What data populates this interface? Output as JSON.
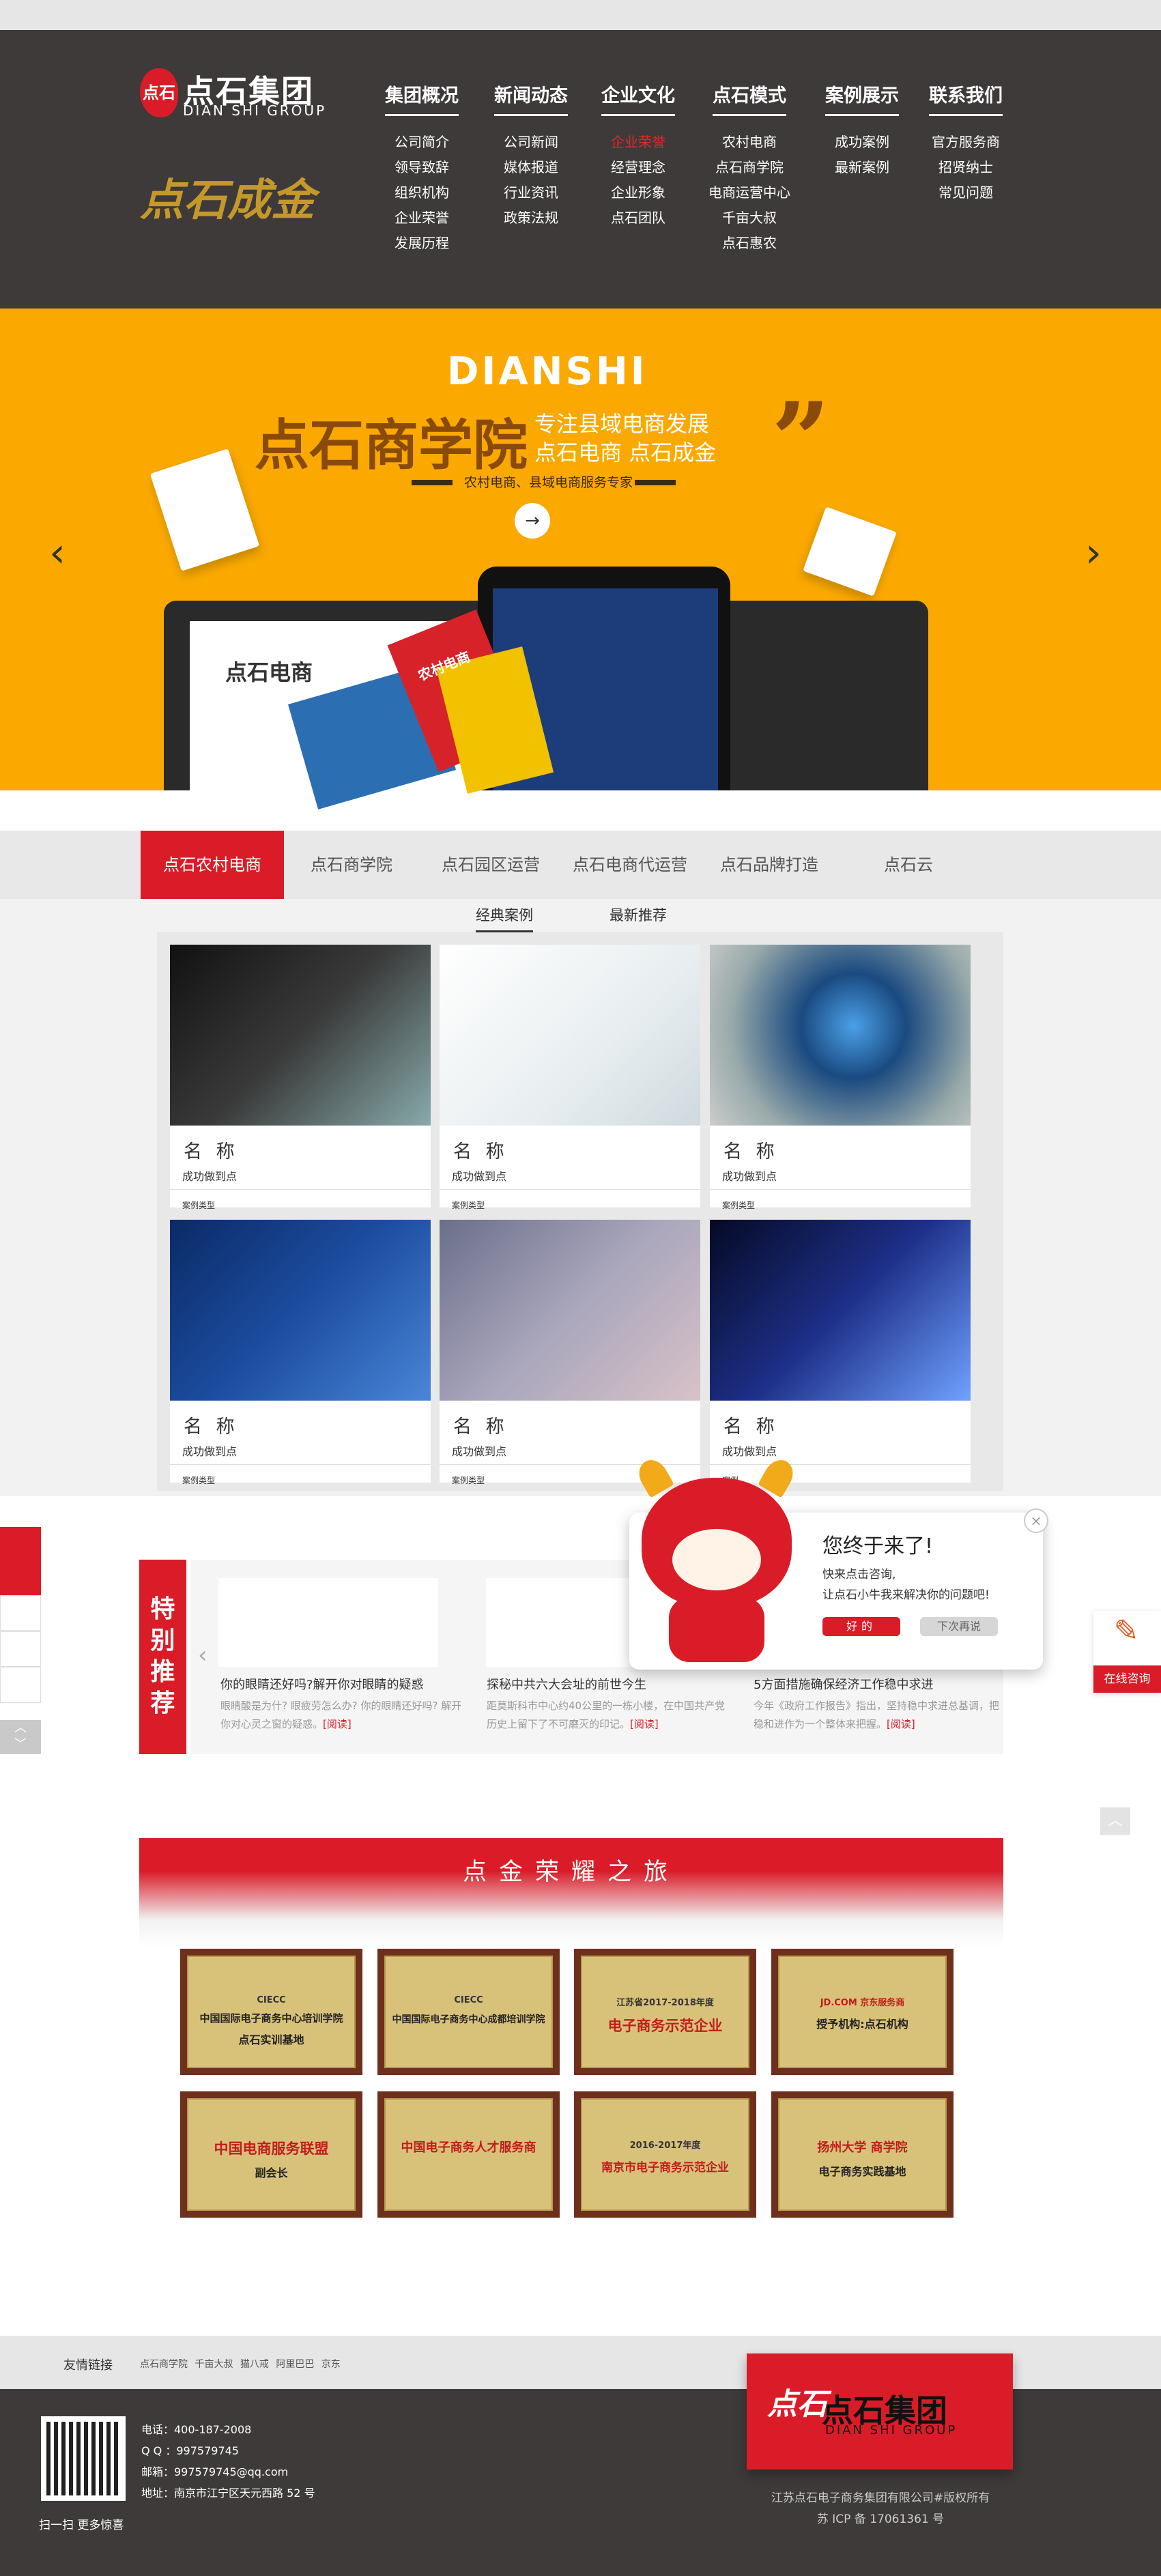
{
  "brand": {
    "mark": "点石",
    "name": "点石集团",
    "sub": "DIAN SHI GROUP",
    "seal": "点石成金"
  },
  "nav": [
    {
      "title": "集团概况",
      "items": [
        "公司简介",
        "领导致辞",
        "组织机构",
        "企业荣誉",
        "发展历程"
      ]
    },
    {
      "title": "新闻动态",
      "items": [
        "公司新闻",
        "媒体报道",
        "行业资讯",
        "政策法规"
      ]
    },
    {
      "title": "企业文化",
      "items": [
        "企业荣誉",
        "经营理念",
        "企业形象",
        "点石团队"
      ]
    },
    {
      "title": "点石模式",
      "items": [
        "农村电商",
        "点石商学院",
        "电商运营中心",
        "千亩大叔",
        "点石惠农"
      ]
    },
    {
      "title": "案例展示",
      "items": [
        "成功案例",
        "最新案例"
      ]
    },
    {
      "title": "联系我们",
      "items": [
        "官方服务商",
        "招贤纳士",
        "常见问题"
      ]
    }
  ],
  "hero": {
    "en": "DIANSHI",
    "title": "点石商学院",
    "sub1": "专注县域电商发展",
    "sub2": "点石电商   点石成金",
    "tag": "农村电商、县域电商服务专家",
    "brand_text": "点石电商",
    "card_text": "农村电商",
    "prev": "‹",
    "next": "›",
    "go": "→"
  },
  "tabs": [
    "点石农村电商",
    "点石商学院",
    "点石园区运营",
    "点石电商代运营",
    "点石品牌打造",
    "点石云"
  ],
  "subtabs": [
    "经典案例",
    "最新推荐"
  ],
  "cases": [
    {
      "name": "名 称",
      "desc": "成功做到点",
      "type": "案例类型"
    },
    {
      "name": "名 称",
      "desc": "成功做到点",
      "type": "案例类型"
    },
    {
      "name": "名 称",
      "desc": "成功做到点",
      "type": "案例类型"
    },
    {
      "name": "名 称",
      "desc": "成功做到点",
      "type": "案例类型"
    },
    {
      "name": "名 称",
      "desc": "成功做到点",
      "type": "案例类型"
    },
    {
      "name": "名 称",
      "desc": "成功做到点",
      "type": "案例"
    }
  ],
  "special": {
    "tag": "特别推荐",
    "news": [
      {
        "title": "你的眼睛还好吗?解开你对眼睛的疑惑",
        "desc": "眼睛酸是为什? 眼疲劳怎么办? 你的眼睛还好吗? 解开你对心灵之窗的疑惑。",
        "more": "[阅读]"
      },
      {
        "title": "探秘中共六大会址的前世今生",
        "desc": "距莫斯科市中心约40公里的一栋小楼，在中国共产党历史上留下了不可磨灭的印记。",
        "more": "[阅读]"
      },
      {
        "title": "5方面措施确保经济工作稳中求进",
        "desc": "今年《政府工作报告》指出，坚持稳中求进总基调，把稳和进作为一个整体来把握。",
        "more": "[阅读]"
      }
    ]
  },
  "popup": {
    "title": "您终于来了!",
    "line1": "快来点击咨询,",
    "line2": "让点石小牛我来解决你的问题吧!",
    "ok": "好的",
    "no": "下次再说",
    "close": "×"
  },
  "online": {
    "label": "在线咨询"
  },
  "sidebar": {
    "updown": "︿\n﹀"
  },
  "to_top": "︿",
  "honor": {
    "title": "点金荣耀之旅",
    "certs": [
      {
        "org": "CIECC",
        "main": "中国国际电子商务中心培训学院",
        "sub": "点石实训基地"
      },
      {
        "org": "CIECC",
        "main": "",
        "sub": "中国国际电子商务中心成都培训学院"
      },
      {
        "org": "江苏省2017-2018年度",
        "main": "电子商务示范企业",
        "sub": ""
      },
      {
        "org": "JD.COM 京东服务商",
        "main": "",
        "sub": "授予机构:点石机构"
      },
      {
        "org": "",
        "main": "中国电商服务联盟",
        "sub": "副会长"
      },
      {
        "org": "",
        "main": "中国电子商务人才服务商",
        "sub": ""
      },
      {
        "org": "2016-2017年度",
        "main": "南京市电子商务示范企业",
        "sub": ""
      },
      {
        "org": "扬州大学 商学院",
        "main": "",
        "sub": "电子商务实践基地"
      }
    ]
  },
  "friend": {
    "label": "友情链接",
    "links": "点石商学院 千亩大叔 猫八戒 阿里巴巴 京东"
  },
  "footer": {
    "qr_label": "扫一扫 更多惊喜",
    "phone": "电话：400-187-2008",
    "qq": "Q Q ：997579745",
    "mail": "邮箱：997579745@qq.com",
    "addr": "地址：南京市江宁区天元西路 52 号",
    "copy1": "江苏点石电子商务集团有限公司#版权所有",
    "copy2": "苏 ICP 备 17061361 号"
  },
  "colors": {
    "brand_red": "#d91c28",
    "banner_yellow": "#fba900",
    "header_dark": "#3d3a39"
  }
}
